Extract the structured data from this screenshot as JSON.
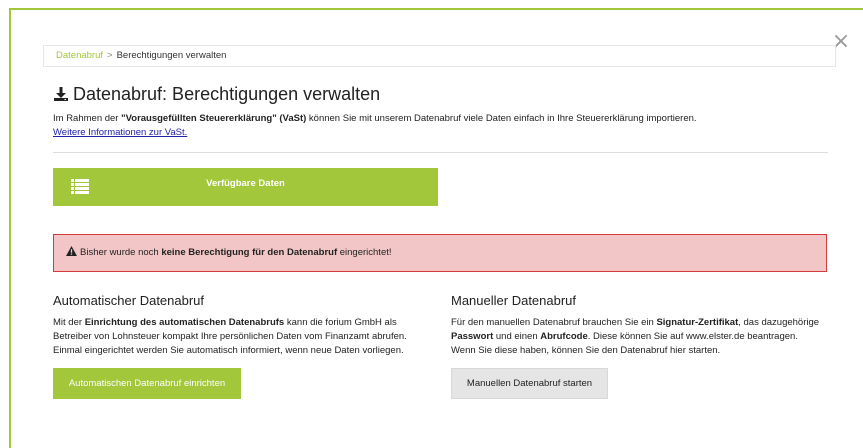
{
  "breadcrumb": {
    "link": "Datenabruf",
    "separator": ">",
    "current": "Berechtigungen verwalten"
  },
  "close_glyph": "×",
  "title": "Datenabruf: Berechtigungen verwalten",
  "intro": {
    "pre": "Im Rahmen der ",
    "bold": "\"Vorausgefüllten Steuererklärung\" (VaSt)",
    "post": " können Sie mit unserem Datenabruf viele Daten einfach in Ihre Steuererklärung importieren.",
    "link": "Weitere Informationen zur VaSt."
  },
  "data_bar": {
    "label": "Verfügbare Daten",
    "icon": "list-icon"
  },
  "alert": {
    "pre": "Bisher wurde noch ",
    "bold": "keine Berechtigung für den Datenabruf",
    "post": " eingerichtet!",
    "icon": "warning-icon"
  },
  "auto": {
    "title": "Automatischer Datenabruf",
    "line1_pre": "Mit der ",
    "line1_bold": "Einrichtung des automatischen Datenabrufs",
    "line1_post": " kann die forium GmbH als",
    "line2": "Betreiber von Lohnsteuer kompakt Ihre persönlichen Daten vom Finanzamt abrufen.",
    "line3": "Einmal eingerichtet werden Sie automatisch informiert, wenn neue Daten vorliegen.",
    "button": "Automatischen Datenabruf einrichten"
  },
  "manual": {
    "title": "Manueller Datenabruf",
    "line1_pre": "Für den manuellen Datenabruf brauchen Sie ein ",
    "line1_bold": "Signatur-Zertifikat",
    "line1_post": ", das dazugehörige",
    "line2_bold1": "Passwort",
    "line2_mid": " und einen ",
    "line2_bold2": "Abrufcode",
    "line2_post": ". Diese können Sie auf www.elster.de beantragen.",
    "line3": "Wenn Sie diese haben, können Sie den Datenabruf hier starten.",
    "button": "Manuellen Datenabruf starten"
  },
  "colors": {
    "accent": "#a3c73b",
    "alert_bg": "#f2c6c6",
    "alert_border": "#d33a3a",
    "link": "#2222aa"
  }
}
